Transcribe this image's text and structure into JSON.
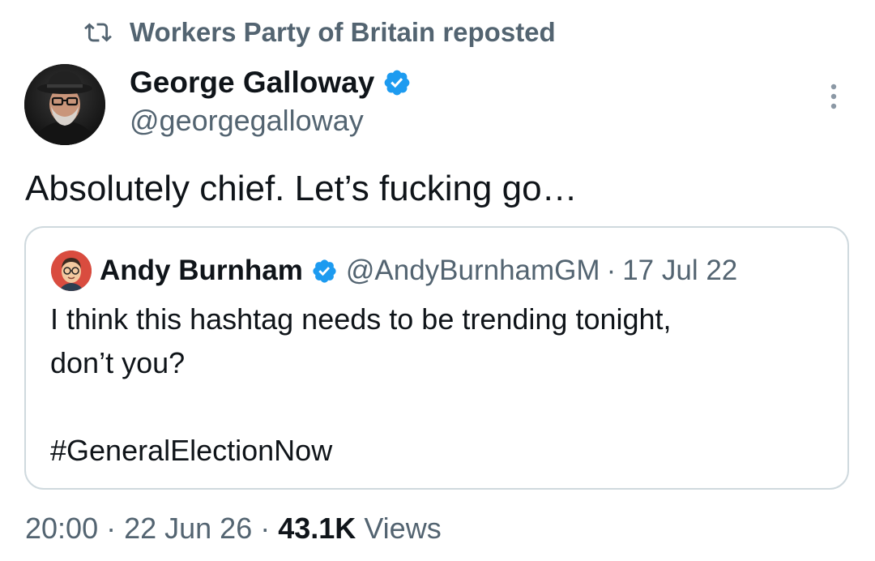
{
  "repost": {
    "icon": "repost-icon",
    "text": "Workers Party of Britain reposted"
  },
  "tweet": {
    "author_name": "George Galloway",
    "author_handle": "@georgegalloway",
    "verified_icon": "verified-badge-icon",
    "more_icon": "more-options-icon",
    "text": "Absolutely chief. Let’s fucking go…",
    "time": "20:00",
    "date": "22 Jun 26",
    "views_count": "43.1K",
    "views_label": "Views",
    "separator": "·"
  },
  "quote": {
    "author_name": "Andy Burnham",
    "author_handle": "@AndyBurnhamGM",
    "separator": "·",
    "date": "17 Jul 22",
    "text_line1": "I think this hashtag needs to be trending tonight,",
    "text_line2": "don’t you?",
    "hashtag": "#GeneralElectionNow"
  },
  "colors": {
    "primary_text": "#0f1419",
    "secondary_text": "#536471",
    "verified_blue": "#1d9bf0",
    "border": "#cfd9de"
  }
}
